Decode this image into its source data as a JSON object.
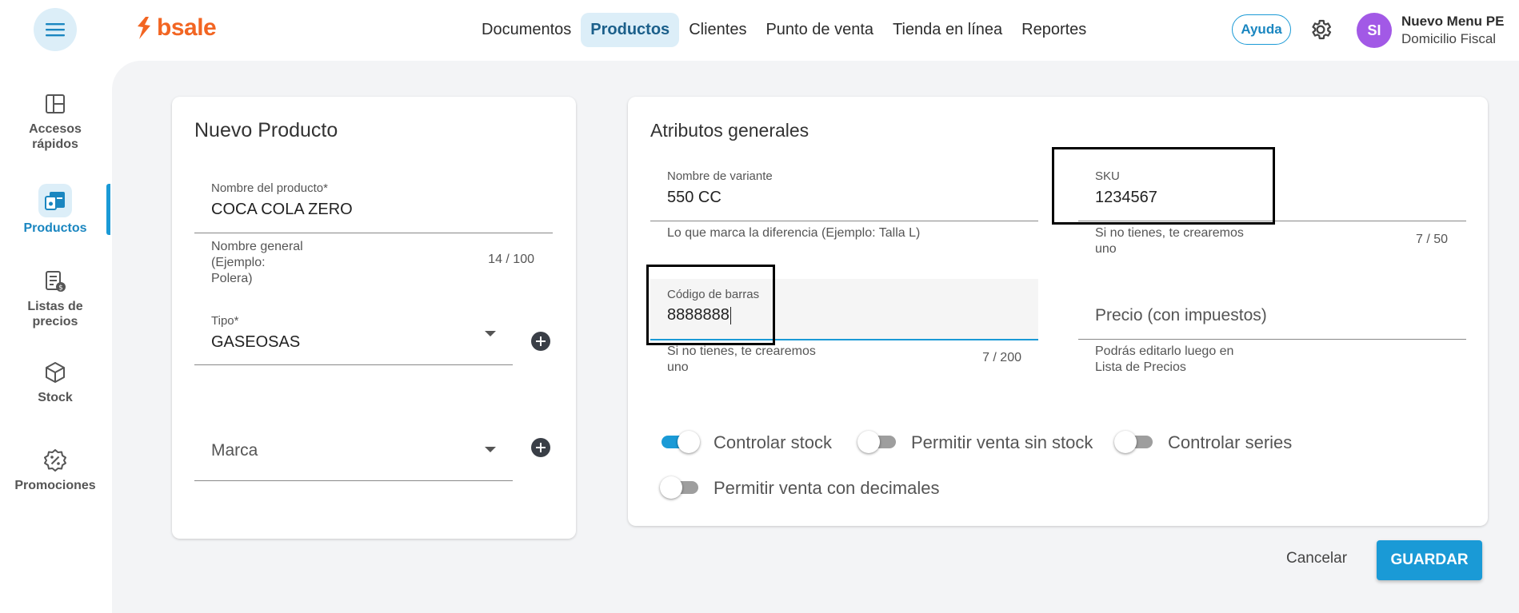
{
  "header": {
    "logo_text": "bsale",
    "nav": [
      {
        "label": "Documentos"
      },
      {
        "label": "Productos"
      },
      {
        "label": "Clientes"
      },
      {
        "label": "Punto de venta"
      },
      {
        "label": "Tienda en línea"
      },
      {
        "label": "Reportes"
      }
    ],
    "active_nav": "Productos",
    "help_label": "Ayuda",
    "avatar_initials": "SI",
    "user_name": "Nuevo Menu PE",
    "user_subtitle": "Domicilio Fiscal"
  },
  "sidebar": {
    "items": [
      {
        "label_line1": "Accesos",
        "label_line2": "rápidos",
        "icon": "grid-layout-icon"
      },
      {
        "label_line1": "Productos",
        "label_line2": "",
        "icon": "products-icon"
      },
      {
        "label_line1": "Listas de",
        "label_line2": "precios",
        "icon": "price-list-icon"
      },
      {
        "label_line1": "Stock",
        "label_line2": "",
        "icon": "cube-icon"
      },
      {
        "label_line1": "Promociones",
        "label_line2": "",
        "icon": "percent-badge-icon"
      }
    ],
    "active": "Productos"
  },
  "new_product": {
    "title": "Nuevo Producto",
    "name_label": "Nombre del producto*",
    "name_value": "COCA COLA ZERO",
    "name_help_line1": "Nombre general",
    "name_help_line2": "(Ejemplo:",
    "name_help_line3": "Polera)",
    "name_count": "14 / 100",
    "type_label": "Tipo*",
    "type_value": "GASEOSAS",
    "brand_placeholder": "Marca"
  },
  "attributes": {
    "title": "Atributos generales",
    "variant_label": "Nombre de variante",
    "variant_value": "550 CC",
    "variant_help": "Lo que marca la diferencia (Ejemplo: Talla L)",
    "sku_label": "SKU",
    "sku_value": "1234567",
    "sku_help_line1": "Si no tienes, te crearemos",
    "sku_help_line2": "uno",
    "sku_count": "7 / 50",
    "barcode_label": "Código de barras",
    "barcode_value": "8888888",
    "barcode_help_line1": "Si no tienes, te crearemos",
    "barcode_help_line2": "uno",
    "barcode_count": "7 / 200",
    "price_placeholder": "Precio (con impuestos)",
    "price_help_line1": "Podrás editarlo luego en",
    "price_help_line2": "Lista de Precios",
    "toggles": [
      {
        "label": "Controlar stock",
        "on": true
      },
      {
        "label": "Permitir venta sin stock",
        "on": false
      },
      {
        "label": "Controlar series",
        "on": false
      },
      {
        "label": "Permitir venta con decimales",
        "on": false
      }
    ]
  },
  "actions": {
    "cancel_label": "Cancelar",
    "save_label": "GUARDAR"
  },
  "colors": {
    "brand": "#f26522",
    "accent": "#1a9ad6",
    "avatar": "#a259e6",
    "background": "#f3f4f6"
  }
}
